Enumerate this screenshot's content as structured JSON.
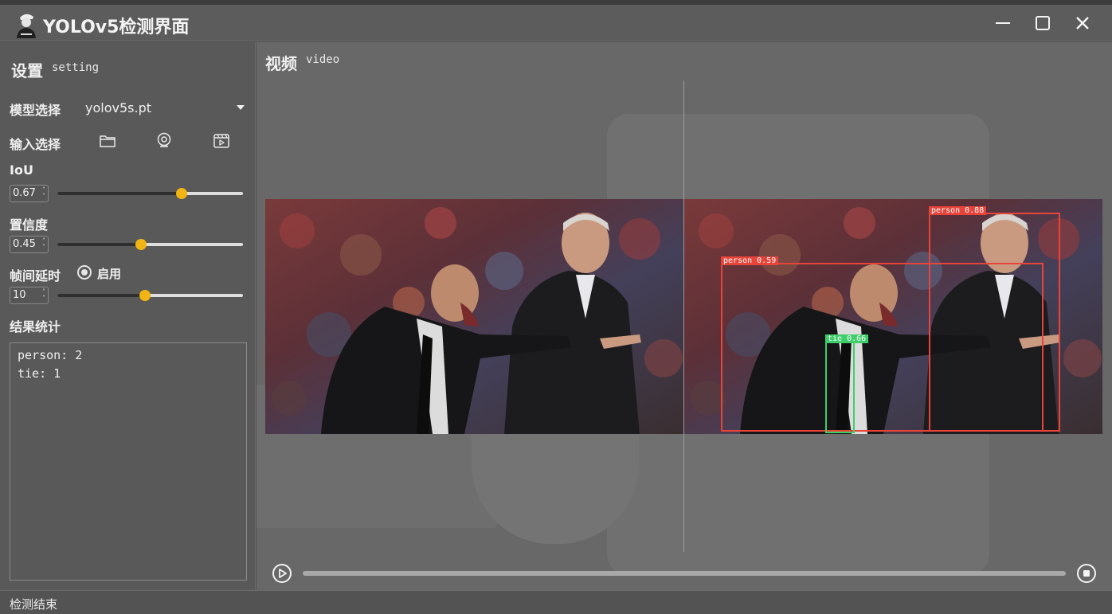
{
  "window": {
    "title": "YOLOv5检测界面",
    "buttons": [
      "minimize",
      "maximize",
      "close"
    ]
  },
  "sidebar": {
    "title": "设置",
    "subtitle": "setting",
    "model": {
      "label": "模型选择",
      "value": "yolov5s.pt"
    },
    "input": {
      "label": "输入选择",
      "icons": [
        "folder-icon",
        "webcam-icon",
        "video-file-icon"
      ]
    },
    "iou": {
      "label": "IoU",
      "value": "0.67",
      "level": 0.67
    },
    "confidence": {
      "label": "置信度",
      "value": "0.45",
      "level": 0.45
    },
    "frame_delay": {
      "label": "帧间延时",
      "value": "10",
      "level": 0.47,
      "toggle_label": "启用",
      "toggle_checked": true
    },
    "results": {
      "label": "结果统计",
      "lines": [
        "person: 2",
        "tie: 1"
      ]
    }
  },
  "video": {
    "title": "视频",
    "subtitle": "video",
    "detections": [
      {
        "label": "person 0.88",
        "class": "person",
        "color": "#e8443a"
      },
      {
        "label": "person 0.59",
        "class": "person",
        "color": "#e8443a"
      },
      {
        "label": "tie 0.66",
        "class": "tie",
        "color": "#3fcf6a"
      }
    ],
    "progress": 0
  },
  "status": {
    "text": "检测结束"
  },
  "colors": {
    "accent": "#f2b413",
    "person_box": "#e8443a",
    "tie_box": "#3fcf6a"
  }
}
